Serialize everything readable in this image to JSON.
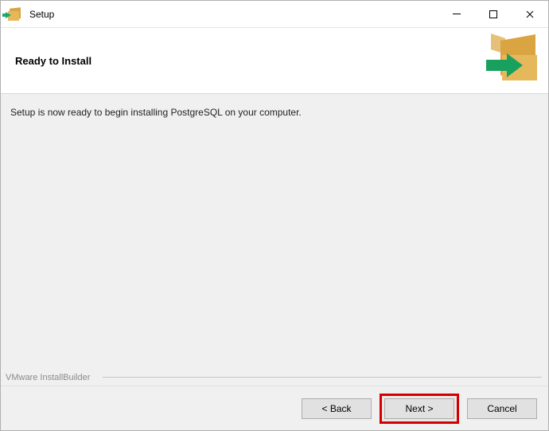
{
  "titlebar": {
    "title": "Setup",
    "icon": "installer-box-icon"
  },
  "window_controls": {
    "minimize": "minimize",
    "maximize": "maximize",
    "close": "close"
  },
  "header": {
    "heading": "Ready to Install",
    "logo": "installer-box-large-icon"
  },
  "body": {
    "message": "Setup is now ready to begin installing PostgreSQL on your computer.",
    "builder_credit": "VMware InstallBuilder"
  },
  "footer": {
    "back_label": "< Back",
    "next_label": "Next >",
    "cancel_label": "Cancel",
    "highlighted_button": "next"
  }
}
